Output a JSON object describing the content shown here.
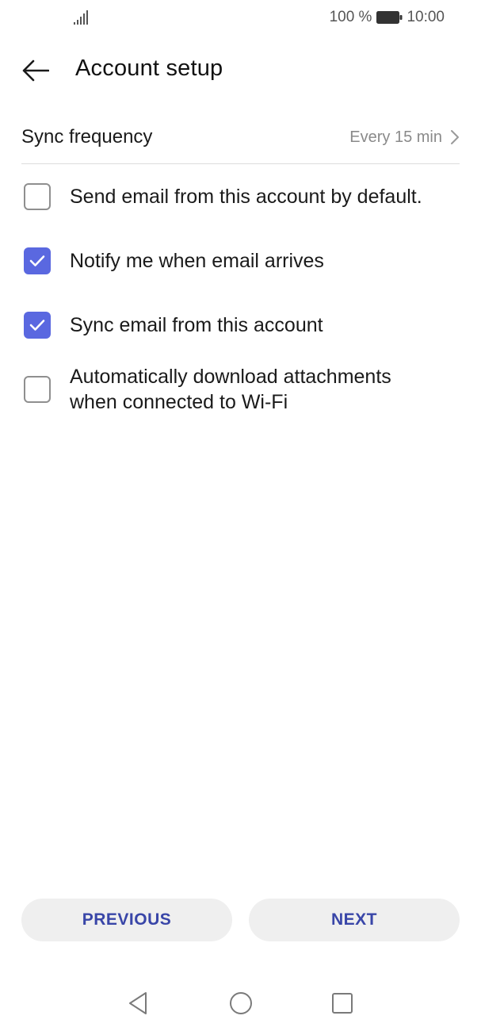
{
  "status_bar": {
    "battery_percent": "100 %",
    "time": "10:00",
    "signal_icon": "signal-bars-icon",
    "battery_icon": "battery-full-icon"
  },
  "header": {
    "title": "Account setup",
    "back_icon": "arrow-left-icon"
  },
  "sync": {
    "label": "Sync frequency",
    "value": "Every 15 min",
    "icon": "chevron-right-icon"
  },
  "options": [
    {
      "label": "Send email from this account by default.",
      "checked": false
    },
    {
      "label": "Notify me when email arrives",
      "checked": true
    },
    {
      "label": "Sync email from this account",
      "checked": true
    },
    {
      "label": "Automatically download attachments when connected to Wi-Fi",
      "checked": false
    }
  ],
  "buttons": {
    "previous": "PREVIOUS",
    "next": "NEXT"
  },
  "nav": {
    "back_icon": "triangle-back-icon",
    "home_icon": "circle-home-icon",
    "recent_icon": "square-recents-icon"
  },
  "colors": {
    "accent": "#5a68e0",
    "button_text": "#3946a8",
    "button_bg": "#efefef",
    "secondary_text": "#8a8a8a"
  }
}
